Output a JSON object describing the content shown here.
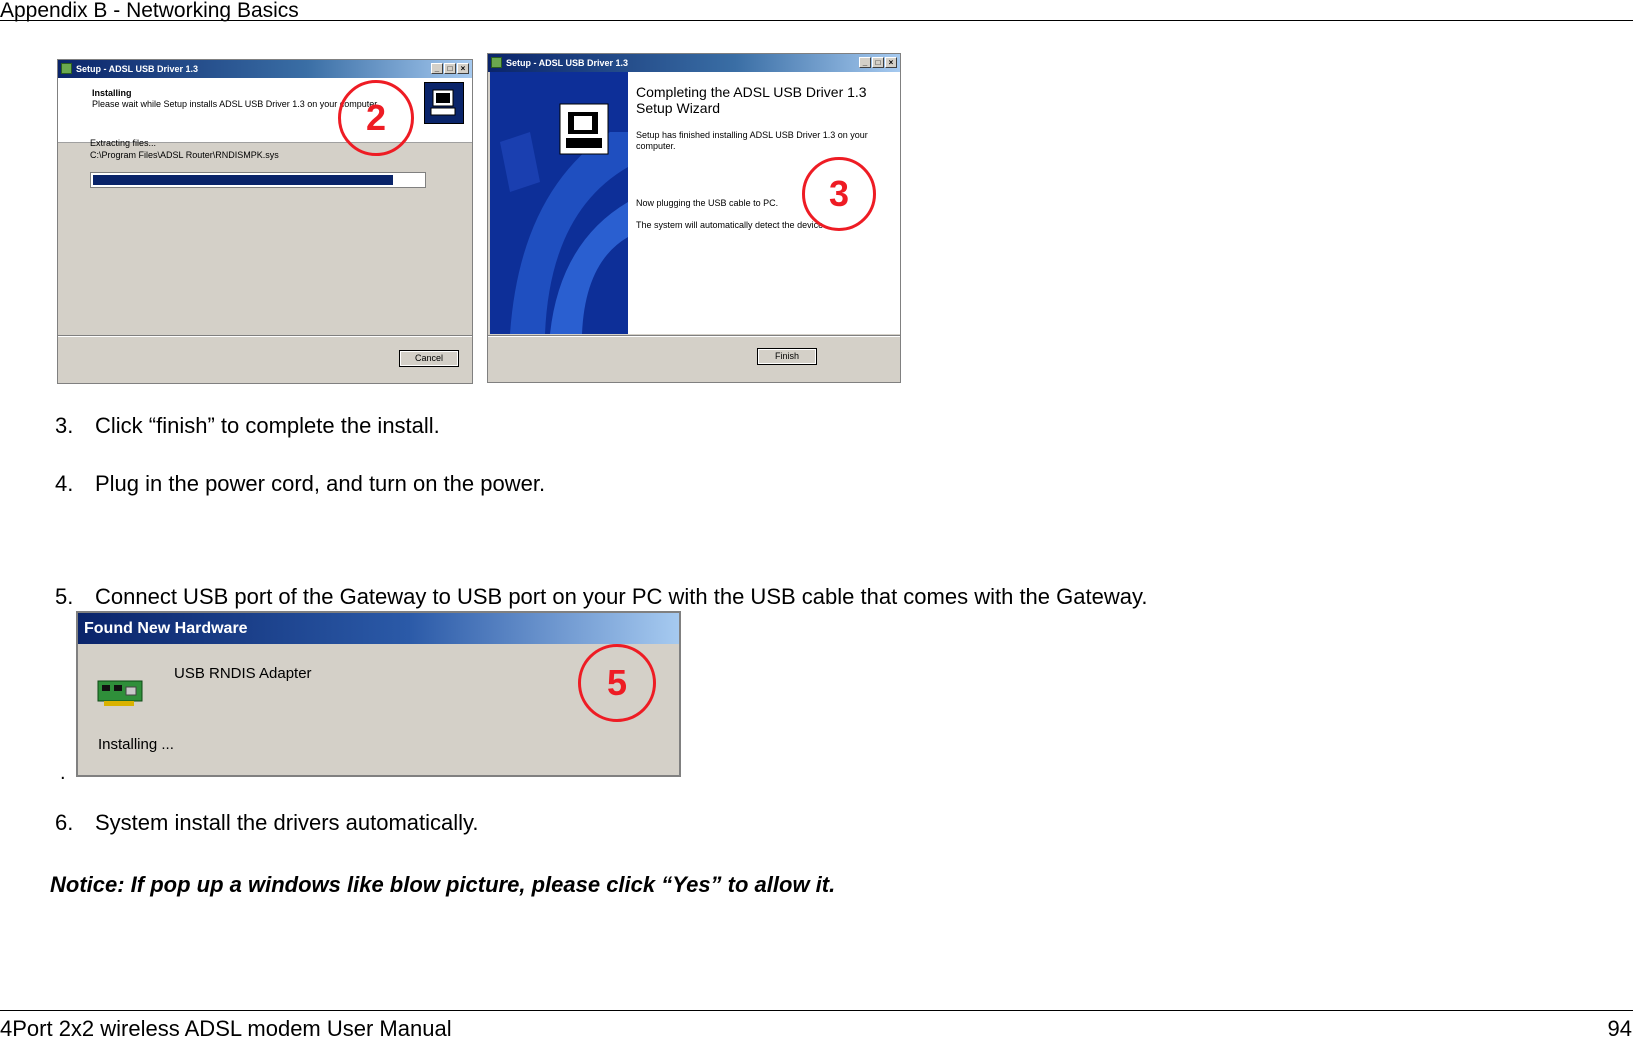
{
  "header": {
    "title": "Appendix B - Networking Basics"
  },
  "dialog_install": {
    "title": "Setup - ADSL USB Driver 1.3",
    "heading": "Installing",
    "subtitle": "Please wait while Setup installs ADSL USB Driver 1.3 on your computer.",
    "status": "Extracting files...",
    "path": "C:\\Program Files\\ADSL Router\\RNDISMPK.sys",
    "progress": 0.91,
    "cancel_label": "Cancel"
  },
  "dialog_finish": {
    "title": "Setup - ADSL USB Driver 1.3",
    "heading": "Completing the ADSL USB Driver 1.3 Setup Wizard",
    "line1": "Setup has finished installing ADSL USB Driver 1.3 on your computer.",
    "line2": "Now plugging the USB cable to PC.",
    "line3": "The system will automatically detect the device.",
    "finish_label": "Finish"
  },
  "callouts": {
    "two": "2",
    "three": "3",
    "five": "5"
  },
  "steps": {
    "s3_num": "3.",
    "s3_text": "Click “finish” to complete the install.",
    "s4_num": "4.",
    "s4_text": "Plug in the power cord, and turn on the power.",
    "s5_num": "5.",
    "s5_text": "Connect USB port of the Gateway to USB port on your PC with the USB cable that comes with the Gateway.",
    "s6_num": "6.",
    "s6_text": "System install the drivers automatically."
  },
  "found_hw": {
    "title": "Found New Hardware",
    "device": "USB RNDIS Adapter",
    "status": "Installing ..."
  },
  "dot": ".",
  "notice": "Notice: If pop up a windows like blow picture, please click “Yes” to allow it.",
  "footer": {
    "manual": "4Port 2x2 wireless ADSL modem User Manual",
    "page": "94"
  }
}
